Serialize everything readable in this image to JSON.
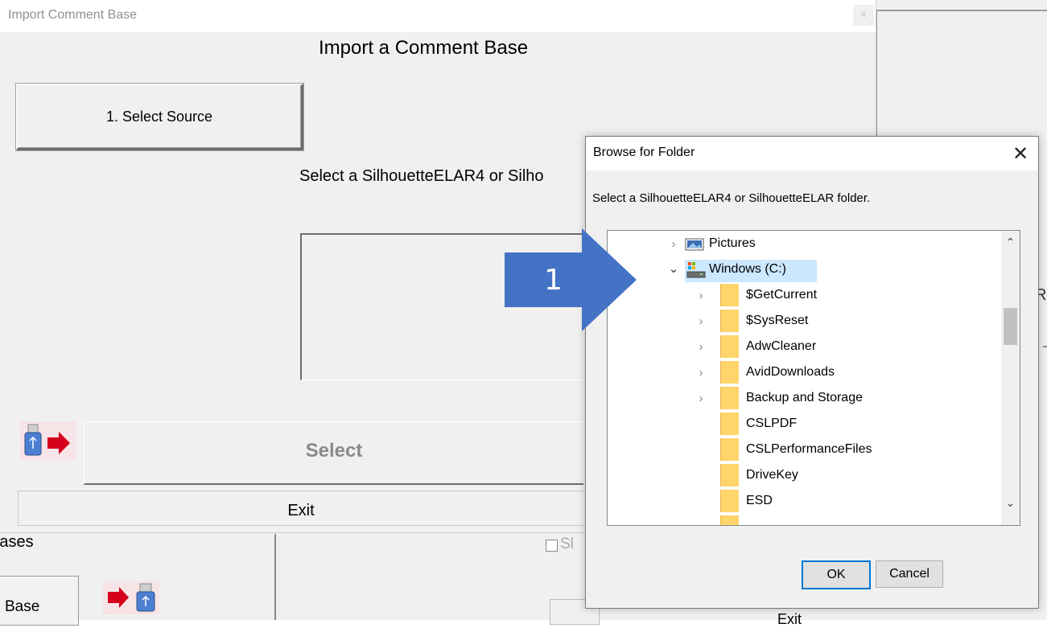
{
  "background_app": {
    "bases_label": "Bases",
    "base_button_label": "Base",
    "checkbox_label": "Sl",
    "exit_label": "Exit",
    "right_letter": "R"
  },
  "import_window": {
    "title": "Import Comment Base",
    "close_glyph": "×",
    "heading": "Import a Comment Base",
    "select_source_label": "1. Select Source",
    "instruction": "Select a SilhouetteELAR4 or Silho",
    "select_label": "Select",
    "exit_label": "Exit"
  },
  "browse_dialog": {
    "title": "Browse for Folder",
    "close_glyph": "✕",
    "description": "Select a SilhouetteELAR4 or SilhouetteELAR folder.",
    "items": [
      {
        "label": "Pictures",
        "expander": "›",
        "icon": "pictures-icon"
      },
      {
        "label": "Windows (C:)",
        "expander": "⌄",
        "icon": "drive-icon",
        "selected": true
      },
      {
        "label": "$GetCurrent",
        "expander": "›",
        "icon": "folder-icon"
      },
      {
        "label": "$SysReset",
        "expander": "›",
        "icon": "folder-icon"
      },
      {
        "label": "AdwCleaner",
        "expander": "›",
        "icon": "folder-icon"
      },
      {
        "label": "AvidDownloads",
        "expander": "›",
        "icon": "folder-icon"
      },
      {
        "label": "Backup and Storage",
        "expander": "›",
        "icon": "folder-icon"
      },
      {
        "label": "CSLPDF",
        "expander": "",
        "icon": "folder-icon"
      },
      {
        "label": "CSLPerformanceFiles",
        "expander": "",
        "icon": "folder-icon"
      },
      {
        "label": "DriveKey",
        "expander": "",
        "icon": "folder-icon"
      },
      {
        "label": "ESD",
        "expander": "",
        "icon": "folder-icon"
      }
    ],
    "scroll_up_glyph": "⌃",
    "scroll_down_glyph": "⌄",
    "ok_label": "OK",
    "cancel_label": "Cancel"
  },
  "callout": {
    "number": "1",
    "color": "#4472c4"
  },
  "colors": {
    "window_bg": "#f0f0f0",
    "selection": "#cce8ff",
    "default_button_border": "#0078d7",
    "folder": "#ffd46a",
    "usb_arrow": "#d6001c"
  }
}
